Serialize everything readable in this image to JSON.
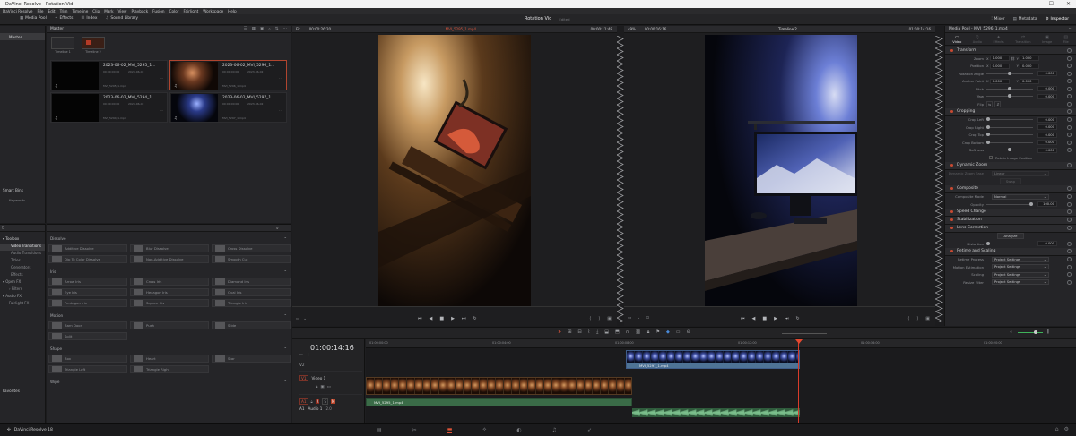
{
  "window": {
    "title": "DaVinci Resolve - Rotation Vid"
  },
  "menu": [
    "DaVinci Resolve",
    "File",
    "Edit",
    "Trim",
    "Timeline",
    "Clip",
    "Mark",
    "View",
    "Playback",
    "Fusion",
    "Color",
    "Fairlight",
    "Workspace",
    "Help"
  ],
  "toolbar": {
    "media_pool": "Media Pool",
    "effects": "Effects",
    "index": "Index",
    "sound_library": "Sound Library",
    "project": "Rotation Vid",
    "edited": "Edited",
    "mixer": "Mixer",
    "metadata": "Metadata",
    "inspector": "Inspector"
  },
  "media_pool": {
    "bin_root": "Master",
    "header": "Master",
    "smart_bins": "Smart Bins",
    "keywords": "Keywords",
    "timelines": [
      {
        "name": "Timeline 1"
      },
      {
        "name": "Timeline 2"
      }
    ],
    "clips": [
      {
        "name": "2023-06-02_MVI_5295_1...",
        "tc1": "00:00:00:00",
        "tc2": "2023-06-02",
        "file": "MVI_5295_1.mp4",
        "type": "dark"
      },
      {
        "name": "2023-06-02_MVI_5296_1...",
        "tc1": "00:00:00:00",
        "tc2": "2023-06-02",
        "file": "MVI_5296_1.mp4",
        "type": "warm"
      },
      {
        "name": "2023-06-02_MVI_5294_1...",
        "tc1": "00:00:00:00",
        "tc2": "2023-06-02",
        "file": "MVI_5294_1.mp4",
        "type": "dark"
      },
      {
        "name": "2023-06-02_MVI_5297_1...",
        "tc1": "00:00:00:00",
        "tc2": "2023-06-02",
        "file": "MVI_5297_1.mp4",
        "type": "blue"
      }
    ]
  },
  "effects_tree": {
    "toolbox": "Toolbox",
    "items": [
      "Video Transitions",
      "Audio Transitions",
      "Titles",
      "Generators",
      "Effects"
    ],
    "open_fx": "Open FX",
    "filters": "Filters",
    "audio_fx": "Audio FX",
    "fairlight_fx": "Fairlight FX",
    "favorites": "Favorites"
  },
  "effects_list": {
    "dissolve_title": "Dissolve",
    "dissolve": [
      "Additive Dissolve",
      "Blur Dissolve",
      "Cross Dissolve",
      "Dip To Color Dissolve",
      "Non-Additive Dissolve",
      "Smooth Cut"
    ],
    "iris_title": "Iris",
    "iris": [
      "Arrow Iris",
      "Cross Iris",
      "Diamond Iris",
      "Eye Iris",
      "Hexagon Iris",
      "Oval Iris",
      "Pentagon Iris",
      "Square Iris",
      "Triangle Iris"
    ],
    "motion_title": "Motion",
    "motion": [
      "Barn Door",
      "Push",
      "Slide",
      "Split"
    ],
    "shape_title": "Shape",
    "shape": [
      "Box",
      "Heart",
      "Star",
      "Triangle Left",
      "Triangle Right"
    ],
    "wipe_title": "Wipe"
  },
  "source_viewer": {
    "zoom": "Fit",
    "in_tc": "00:00:26:20",
    "clip": "MVI_5295_1.mp4",
    "dur": "00:00:11:48"
  },
  "timeline_viewer": {
    "zoom": "49%",
    "in_tc": "00:00:16:16",
    "timeline": "Timeline 2",
    "tc": "01:00:14:16"
  },
  "timeline": {
    "timecode": "01:00:14:16",
    "ruler": [
      "01:00:00:00",
      "01:00:04:00",
      "01:00:08:00",
      "01:00:12:00",
      "01:00:16:00",
      "01:00:20:00"
    ],
    "v2": "V2",
    "v1": "V1",
    "video1": "Video 1",
    "a1": "A1",
    "audio1": "Audio 1",
    "a1_level": "2.0",
    "clip_v1": "MVI_5295_1.mp4",
    "clip_v2": "MVI_5297_1.mp4",
    "clip_a1": "MVI_5295_1.mp4"
  },
  "inspector": {
    "title": "Media Pool - MVI_5296_1.mp4",
    "tabs": [
      "Video",
      "Audio",
      "Effects",
      "Transition",
      "Image",
      "File"
    ],
    "transform": "Transform",
    "zoom_label": "Zoom",
    "zoom_x": "1.000",
    "zoom_y": "1.000",
    "position_label": "Position",
    "pos_x": "0.000",
    "pos_y": "0.000",
    "rotation_label": "Rotation Angle",
    "rotation": "0.000",
    "anchor_label": "Anchor Point",
    "anchor_x": "0.000",
    "anchor_y": "0.000",
    "pitch_label": "Pitch",
    "pitch": "0.000",
    "yaw_label": "Yaw",
    "yaw": "0.000",
    "flip_label": "Flip",
    "cropping": "Cropping",
    "crop_left_label": "Crop Left",
    "crop_left": "0.000",
    "crop_right_label": "Crop Right",
    "crop_right": "0.000",
    "crop_top_label": "Crop Top",
    "crop_top": "0.000",
    "crop_bottom_label": "Crop Bottom",
    "crop_bottom": "0.000",
    "softness_label": "Softness",
    "softness": "0.000",
    "retain_label": "Retain Image Position",
    "dynamic_zoom": "Dynamic Zoom",
    "dz_ease_label": "Dynamic Zoom Ease",
    "dz_ease": "Linear",
    "dz_swap": "Swap",
    "composite": "Composite",
    "comp_mode_label": "Composite Mode",
    "comp_mode": "Normal",
    "opacity_label": "Opacity",
    "opacity": "100.00",
    "speed_change": "Speed Change",
    "stabilization": "Stabilization",
    "lens_correction": "Lens Correction",
    "analyze": "Analyze",
    "distortion_label": "Distortion",
    "distortion": "0.000",
    "retime": "Retime and Scaling",
    "retime_process_label": "Retime Process",
    "retime_process": "Project Settings",
    "motion_est_label": "Motion Estimation",
    "motion_est": "Project Settings",
    "scaling_label": "Scaling",
    "scaling": "Project Settings",
    "resize_filter_label": "Resize Filter",
    "resize_filter": "Project Settings"
  },
  "bottom": {
    "app": "DaVinci Resolve 18"
  }
}
